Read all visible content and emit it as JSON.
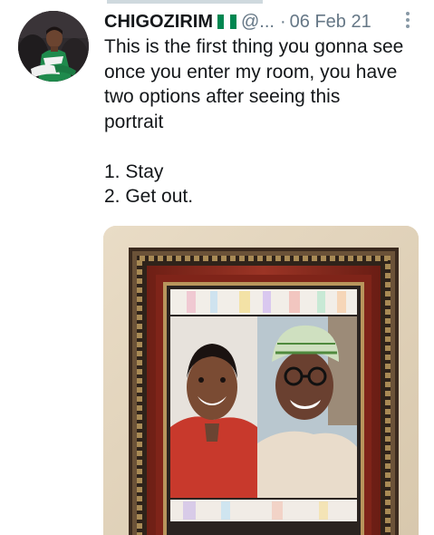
{
  "tweet": {
    "display_name": "CHIGOZIRIM",
    "handle": "@...",
    "separator": "·",
    "date": "06 Feb 21",
    "text_lines": [
      "This is the first thing you gonna see",
      "once you enter my room, you have",
      "two options after seeing this",
      "portrait"
    ],
    "options": [
      "1. Stay",
      "2. Get out."
    ]
  },
  "icons": {
    "flag": "nigeria-flag-icon",
    "more": "more-vertical-icon",
    "avatar": "profile-avatar"
  },
  "colors": {
    "text": "#14171a",
    "secondary": "#657786",
    "flag_green": "#008751",
    "frame_red": "#8a2a1e"
  }
}
